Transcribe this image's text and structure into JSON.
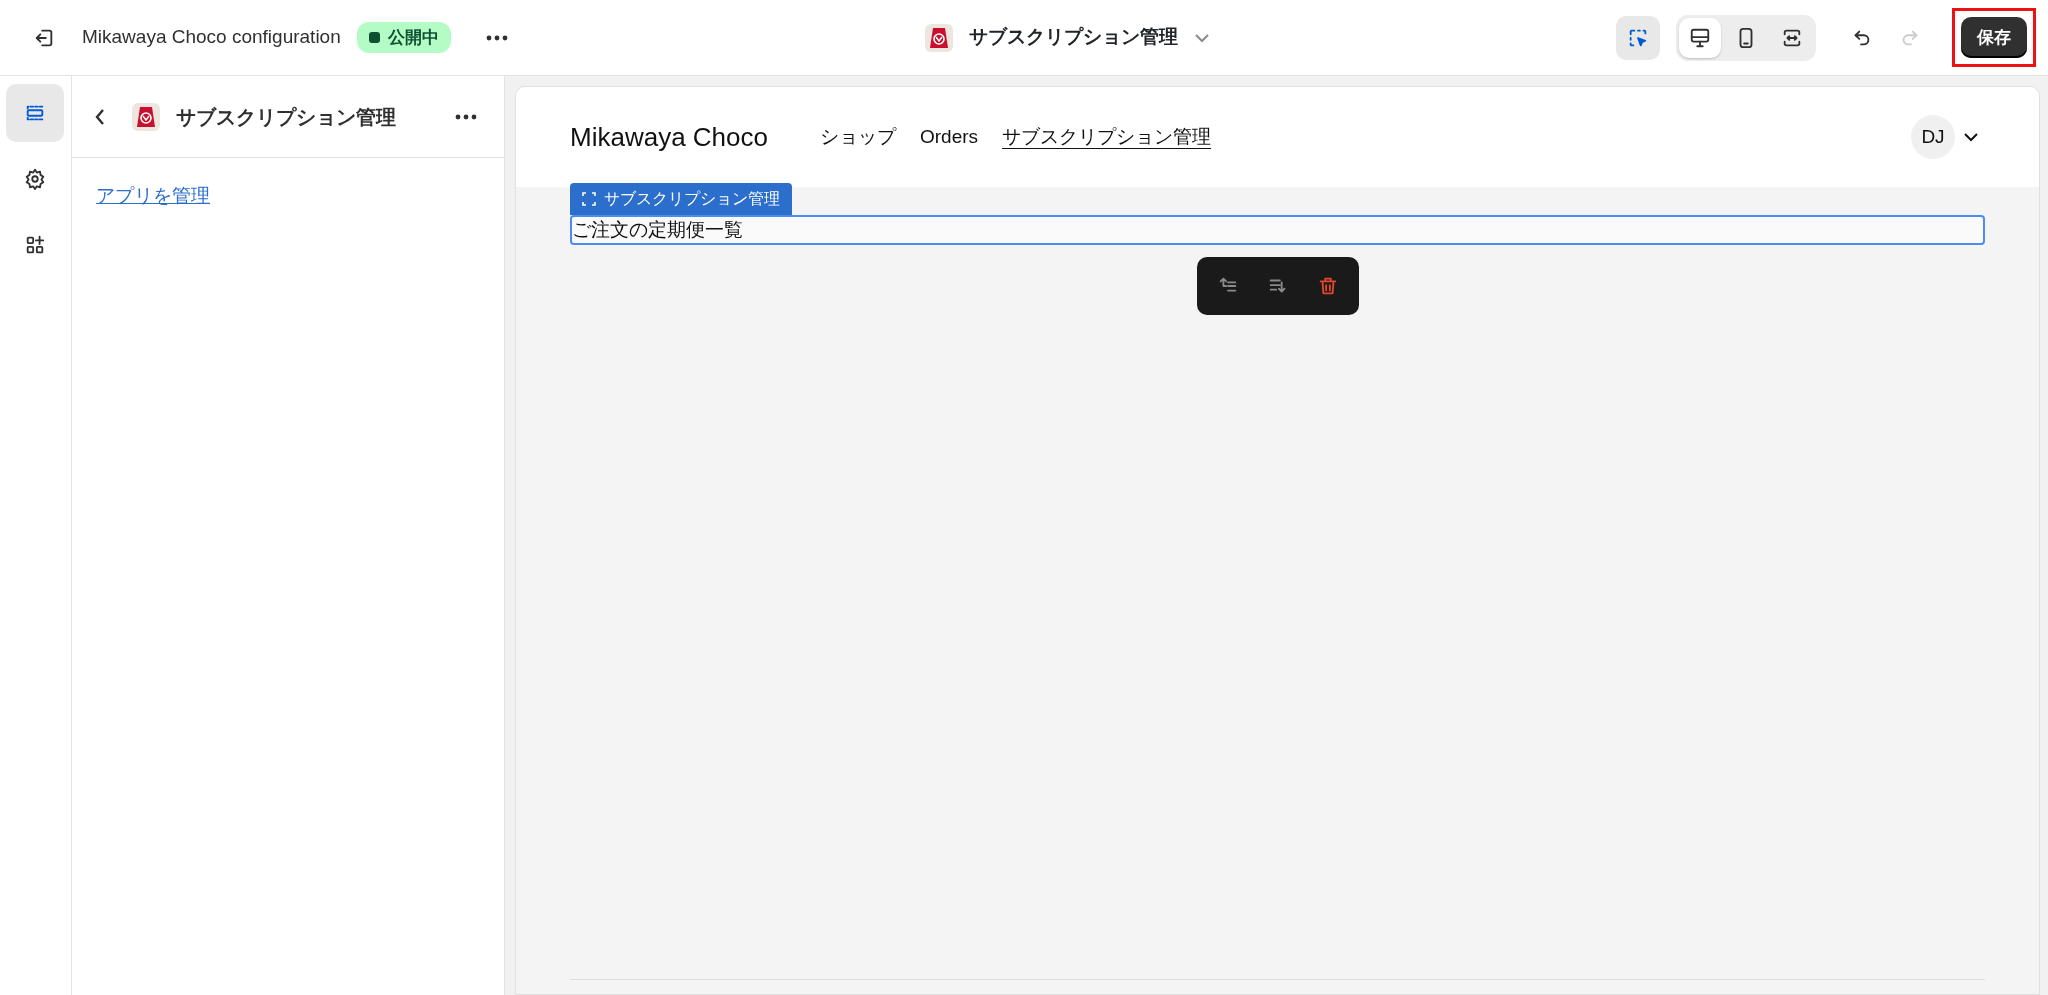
{
  "topbar": {
    "title": "Mikawaya Choco configuration",
    "status": {
      "label": "公開中",
      "color": "#b4fcc6"
    },
    "app_selector": {
      "label": "サブスクリプション管理"
    },
    "inspector": {
      "selected": true
    },
    "views": [
      {
        "kind": "desktop",
        "selected": true
      },
      {
        "kind": "mobile",
        "selected": false
      },
      {
        "kind": "fullwidth",
        "selected": false
      }
    ],
    "undo": {
      "disabled": false
    },
    "redo": {
      "disabled": true
    },
    "save": {
      "label": "保存",
      "highlighted": true
    }
  },
  "rail": [
    {
      "kind": "sections",
      "selected": true
    },
    {
      "kind": "settings",
      "selected": false
    },
    {
      "kind": "apps",
      "selected": false
    }
  ],
  "sidebar": {
    "title": "サブスクリプション管理",
    "link": "アプリを管理"
  },
  "preview": {
    "store_name": "Mikawaya Choco",
    "nav": [
      {
        "label": "ショップ",
        "selected": false
      },
      {
        "label": "Orders",
        "selected": false
      },
      {
        "label": "サブスクリプション管理",
        "selected": true
      }
    ],
    "avatar": "DJ",
    "block": {
      "label": "サブスクリプション管理",
      "text": "ご注文の定期便一覧",
      "selected": true
    },
    "block_toolbar": [
      {
        "kind": "move-up"
      },
      {
        "kind": "move-down"
      },
      {
        "kind": "delete"
      }
    ]
  }
}
